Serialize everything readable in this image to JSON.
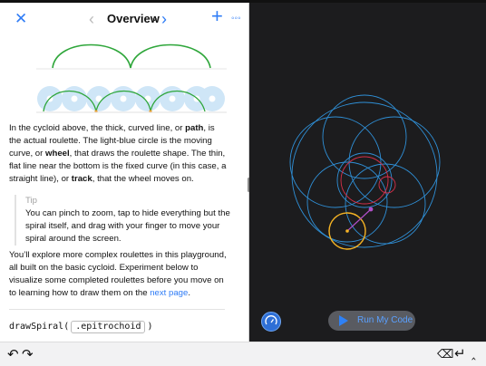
{
  "nav": {
    "title": "Overview",
    "icons": {
      "close": "✕",
      "prev": "‹",
      "next": "›",
      "add": "+",
      "more": "◦◦◦",
      "chevron": "⌄"
    }
  },
  "content": {
    "para1": [
      {
        "t": "In the cycloid above, the thick, curved line, or "
      },
      {
        "t": "path",
        "b": true
      },
      {
        "t": ", is the actual roulette. The light-blue circle is the moving curve, or "
      },
      {
        "t": "wheel",
        "b": true
      },
      {
        "t": ", that draws the roulette shape. The thin, flat line near the bottom is the fixed curve (in this case, a straight line), or "
      },
      {
        "t": "track",
        "b": true
      },
      {
        "t": ", that the wheel moves on."
      }
    ],
    "tip_label": "Tip",
    "tip_text": "You can pinch to zoom, tap to hide everything but the spiral itself, and drag with your finger to move your spiral around the screen.",
    "para2_text": "You’ll explore more complex roulettes in this playground, all built on the basic cycloid. Experiment below to visualize some completed roulettes before you move on to learning how to draw them on the ",
    "para2_link": "next page",
    "para2_end": ".",
    "code_fn": "drawSpiral(",
    "code_arg": ".epitrochoid",
    "code_close": ")"
  },
  "live_view": {
    "run_label": "Run My Code",
    "colors": {
      "background": "#1c1c1e",
      "spiral": "#2f8fd6",
      "inner_curve": "#d8304a",
      "wheel": "#f5b324",
      "pen": "#b04fc8",
      "button_accent": "#2e81f6"
    }
  },
  "toolbar": {
    "undo": "↶",
    "redo": "↷",
    "delete": "⌫",
    "return": "↵",
    "hide": "‸"
  },
  "colors": {
    "accent": "#2f7cf6",
    "cycloid_path": "#2ea63a",
    "cycloid_wheel": "#cfe6f7"
  }
}
